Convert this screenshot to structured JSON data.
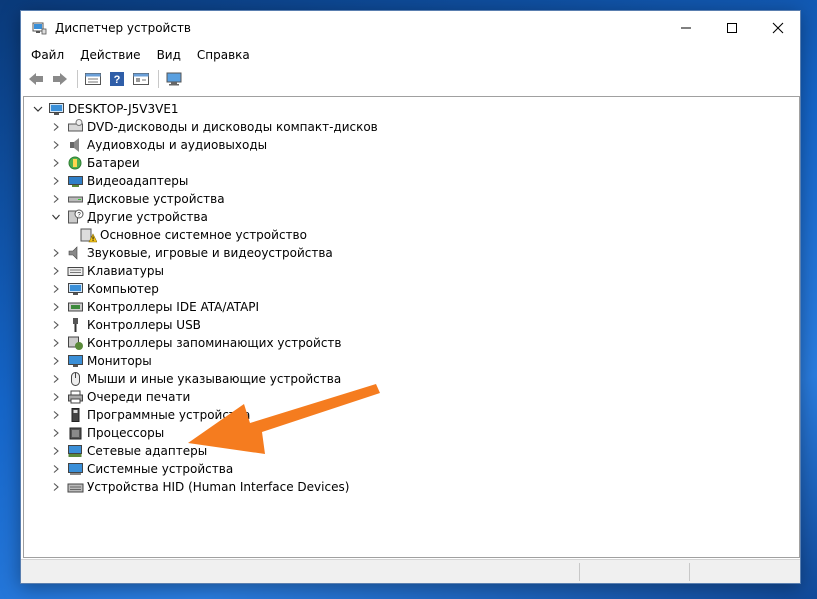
{
  "window": {
    "title": "Диспетчер устройств",
    "controls": {
      "minimize": "—",
      "maximize": "☐",
      "close": "✕"
    }
  },
  "menubar": {
    "items": [
      "Файл",
      "Действие",
      "Вид",
      "Справка"
    ]
  },
  "toolbar": {
    "buttons": [
      "back-icon",
      "forward-icon",
      "properties-icon",
      "help-icon",
      "view-icon",
      "scan-hardware-icon"
    ]
  },
  "tree": {
    "root": "DESKTOP-J5V3VE1",
    "items": [
      {
        "label": "DVD-дисководы и дисководы компакт-дисков",
        "icon": "dvd-drive-icon",
        "state": "collapsed"
      },
      {
        "label": "Аудиовходы и аудиовыходы",
        "icon": "audio-io-icon",
        "state": "collapsed"
      },
      {
        "label": "Батареи",
        "icon": "battery-icon",
        "state": "collapsed"
      },
      {
        "label": "Видеоадаптеры",
        "icon": "display-adapter-icon",
        "state": "collapsed"
      },
      {
        "label": "Дисковые устройства",
        "icon": "disk-drive-icon",
        "state": "collapsed"
      },
      {
        "label": "Другие устройства",
        "icon": "other-devices-icon",
        "state": "expanded"
      },
      {
        "label": "Основное системное устройство",
        "icon": "warning-device-icon",
        "state": "child"
      },
      {
        "label": "Звуковые, игровые и видеоустройства",
        "icon": "sound-icon",
        "state": "collapsed"
      },
      {
        "label": "Клавиатуры",
        "icon": "keyboard-icon",
        "state": "collapsed"
      },
      {
        "label": "Компьютер",
        "icon": "computer-icon",
        "state": "collapsed"
      },
      {
        "label": "Контроллеры IDE ATA/ATAPI",
        "icon": "ide-controller-icon",
        "state": "collapsed"
      },
      {
        "label": "Контроллеры USB",
        "icon": "usb-icon",
        "state": "collapsed"
      },
      {
        "label": "Контроллеры запоминающих устройств",
        "icon": "storage-controller-icon",
        "state": "collapsed"
      },
      {
        "label": "Мониторы",
        "icon": "monitor-icon",
        "state": "collapsed"
      },
      {
        "label": "Мыши и иные указывающие устройства",
        "icon": "mouse-icon",
        "state": "collapsed"
      },
      {
        "label": "Очереди печати",
        "icon": "printer-icon",
        "state": "collapsed"
      },
      {
        "label": "Программные устройства",
        "icon": "software-device-icon",
        "state": "collapsed"
      },
      {
        "label": "Процессоры",
        "icon": "processor-icon",
        "state": "collapsed"
      },
      {
        "label": "Сетевые адаптеры",
        "icon": "network-adapter-icon",
        "state": "collapsed"
      },
      {
        "label": "Системные устройства",
        "icon": "system-device-icon",
        "state": "collapsed"
      },
      {
        "label": "Устройства HID (Human Interface Devices)",
        "icon": "hid-icon",
        "state": "collapsed"
      }
    ]
  },
  "annotation": {
    "arrow_color": "#f57c1f",
    "points_to": "Сетевые адаптеры"
  },
  "colors": {
    "desktop": "#1565c8",
    "arrow": "#f57c1f"
  }
}
